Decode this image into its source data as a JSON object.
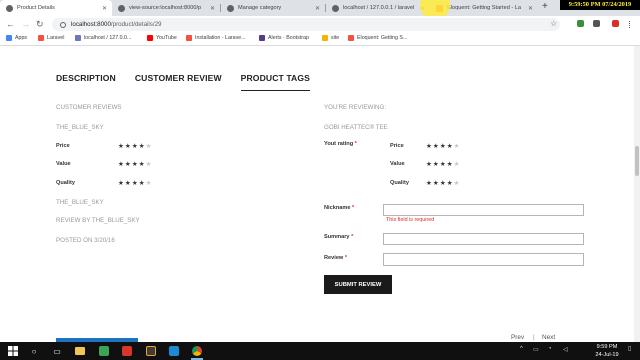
{
  "browser": {
    "tabs": [
      {
        "title": "Product Details"
      },
      {
        "title": "view-source:localhost:8000/p"
      },
      {
        "title": "Manage category"
      },
      {
        "title": "localhost / 127.0.0.1 / laravel"
      },
      {
        "title": "Eloquent: Getting Started - La"
      }
    ],
    "clock_overlay": "9:59:50 PM 07/24/2019",
    "url_host": "localhost:8000",
    "url_path": "/product/details/29",
    "bookmarks": [
      {
        "label": "Apps"
      },
      {
        "label": "Laravel"
      },
      {
        "label": "localhost / 127.0.0..."
      },
      {
        "label": "YouTube"
      },
      {
        "label": "Installation - Larave..."
      },
      {
        "label": "Alerts · Bootstrap"
      },
      {
        "label": "site"
      },
      {
        "label": "Eloquent: Getting S..."
      }
    ]
  },
  "page": {
    "tabs": [
      "DESCRIPTION",
      "CUSTOMER REVIEW",
      "PRODUCT TAGS"
    ],
    "left": {
      "customer_reviews": "CUSTOMER REVIEWS",
      "reviewer": "THE_BLUE_SKY",
      "ratings": [
        {
          "label": "Price",
          "stars": 4
        },
        {
          "label": "Value",
          "stars": 4
        },
        {
          "label": "Quality",
          "stars": 4
        }
      ],
      "review_title": "THE_BLUE_SKY",
      "review_by": "REVIEW BY THE_BLUE_SKY",
      "posted_on": "POSTED ON 3/20/16"
    },
    "right": {
      "reviewing": "YOU'RE REVIEWING:",
      "product": "GOBI HEATTEC® TEE",
      "your_rating": "Yout rating",
      "ratings": [
        {
          "label": "Price",
          "stars": 4
        },
        {
          "label": "Value",
          "stars": 4
        },
        {
          "label": "Quality",
          "stars": 4
        }
      ],
      "nickname_label": "Nickname",
      "error": "This field is required",
      "summary_label": "Summary",
      "review_label": "Review",
      "required_mark": "*",
      "submit": "SUBMIT REVIEW"
    },
    "pager_prev": "Prev",
    "pager_sep": "|",
    "pager_next": "Next"
  },
  "taskbar": {
    "time": "9:59 PM",
    "date": "24-Jul-19"
  }
}
